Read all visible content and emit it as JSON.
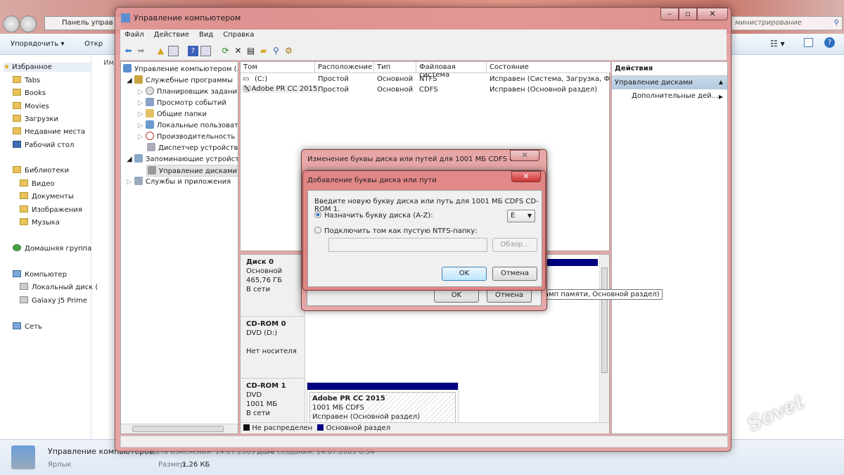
{
  "explorer": {
    "address": "Панель управ",
    "search_placeholder": "министрирование",
    "toolbar": {
      "organize": "Упорядочить ▾",
      "open": "Откр"
    },
    "column_name": "Им",
    "nav": {
      "favorites": "Избранное",
      "favorites_items": [
        "Tabs",
        "Books",
        "Movies",
        "Загрузки",
        "Недавние места",
        "Рабочий стол"
      ],
      "libraries": "Библиотеки",
      "libraries_items": [
        "Видео",
        "Документы",
        "Изображения",
        "Музыка"
      ],
      "homegroup": "Домашняя группа",
      "computer": "Компьютер",
      "computer_items": [
        "Локальный диск (",
        "Galaxy J5 Prime"
      ],
      "network": "Сеть"
    },
    "details": {
      "name": "Управление компьютером",
      "type": "Ярлык",
      "modified": "Дата изменения: 14.07.2009 6:54",
      "created": "Дата создания: 14.07.2009 6:54",
      "size_label": "Размер:",
      "size": "1,26 КБ"
    }
  },
  "window": {
    "title": "Управление компьютером",
    "menu": [
      "Файл",
      "Действие",
      "Вид",
      "Справка"
    ],
    "tree": {
      "root": "Управление компьютером (л",
      "utilities": "Служебные программы",
      "utilities_items": [
        "Планировщик заданий",
        "Просмотр событий",
        "Общие папки",
        "Локальные пользовате",
        "Производительность",
        "Диспетчер устройств"
      ],
      "storage": "Запоминающие устройст",
      "disk_mgmt": "Управление дисками",
      "services": "Службы и приложения"
    },
    "columns": [
      "Том",
      "Расположение",
      "Тип",
      "Файловая система",
      "Состояние"
    ],
    "volumes": [
      [
        "(C:)",
        "Простой",
        "Основной",
        "NTFS",
        "Исправен (Система, Загрузка, Фай"
      ],
      [
        "Adobe PR CC 2015",
        "Простой",
        "Основной",
        "CDFS",
        "Исправен (Основной раздел)"
      ]
    ],
    "disks": [
      {
        "name": "Диск 0",
        "lines": [
          "Основной",
          "465,76 ГБ",
          "В сети"
        ]
      },
      {
        "name": "CD-ROM 0",
        "lines": [
          "DVD (D:)",
          "",
          "Нет носителя"
        ]
      },
      {
        "name": "CD-ROM 1",
        "lines": [
          "DVD",
          "1001 МБ",
          "В сети"
        ],
        "partition": {
          "name": "Adobe PR CC 2015",
          "fs": "1001 МБ CDFS",
          "status": "Исправен (Основной раздел)"
        }
      }
    ],
    "tooltip": "амп памяти, Основной раздел)",
    "legend": [
      {
        "label": "Не распределен",
        "color": "#111111"
      },
      {
        "label": "Основной раздел",
        "color": "#000080"
      }
    ],
    "actions": {
      "header": "Действия",
      "section": "Управление дисками",
      "more": "Дополнительные дей..."
    }
  },
  "dialog_back": {
    "title": "Изменение буквы диска или путей для 1001 МБ CDFS  CD...",
    "ok": "OK",
    "cancel": "Отмена"
  },
  "dialog": {
    "title": "Добавление буквы диска или пути",
    "prompt": "Введите новую букву диска или путь для 1001 МБ CDFS  CD-ROM 1.",
    "option_letter": "Назначить букву диска (A-Z):",
    "letter": "E",
    "option_folder": "Подключить том как пустую NTFS-папку:",
    "browse": "Обзор...",
    "ok": "OK",
    "cancel": "Отмена"
  },
  "watermark": "club Sovet"
}
